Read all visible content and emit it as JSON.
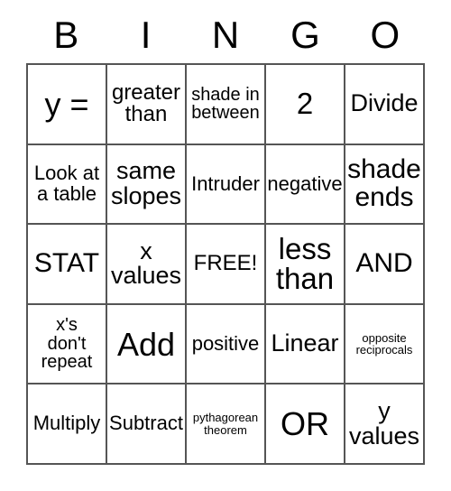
{
  "card": {
    "title": "BINGO",
    "header_letters": [
      "B",
      "I",
      "N",
      "G",
      "O"
    ],
    "free_space_label": "FREE!",
    "colors": {
      "background": "#ffffff",
      "text": "#000000",
      "grid_line": "#555555"
    },
    "grid": {
      "columns": 5,
      "rows": 5,
      "cells": [
        {
          "text": "y =",
          "size": "t-xxl"
        },
        {
          "text": "greater\nthan",
          "size": "t-sm"
        },
        {
          "text": "shade in\nbetween",
          "size": "t-xxs"
        },
        {
          "text": "2",
          "size": "t-xl"
        },
        {
          "text": "Divide",
          "size": "t-md"
        },
        {
          "text": "Look at\na table",
          "size": "t-xs"
        },
        {
          "text": "same\nslopes",
          "size": "t-md"
        },
        {
          "text": "Intruder",
          "size": "t-xs"
        },
        {
          "text": "negative",
          "size": "t-xs"
        },
        {
          "text": "shade\nends",
          "size": "t-lg"
        },
        {
          "text": "STAT",
          "size": "t-lg"
        },
        {
          "text": "x\nvalues",
          "size": "t-md"
        },
        {
          "text": "FREE!",
          "size": "t-sm"
        },
        {
          "text": "less\nthan",
          "size": "t-xl"
        },
        {
          "text": "AND",
          "size": "t-lg"
        },
        {
          "text": "x's\ndon't\nrepeat",
          "size": "t-xxs"
        },
        {
          "text": "Add",
          "size": "t-xxl"
        },
        {
          "text": "positive",
          "size": "t-xs"
        },
        {
          "text": "Linear",
          "size": "t-md"
        },
        {
          "text": "opposite\nreciprocals",
          "size": "t-tiny"
        },
        {
          "text": "Multiply",
          "size": "t-xs"
        },
        {
          "text": "Subtract",
          "size": "t-xs"
        },
        {
          "text": "pythagorean\ntheorem",
          "size": "t-tiny"
        },
        {
          "text": "OR",
          "size": "t-xxl"
        },
        {
          "text": "y\nvalues",
          "size": "t-md"
        }
      ]
    }
  }
}
